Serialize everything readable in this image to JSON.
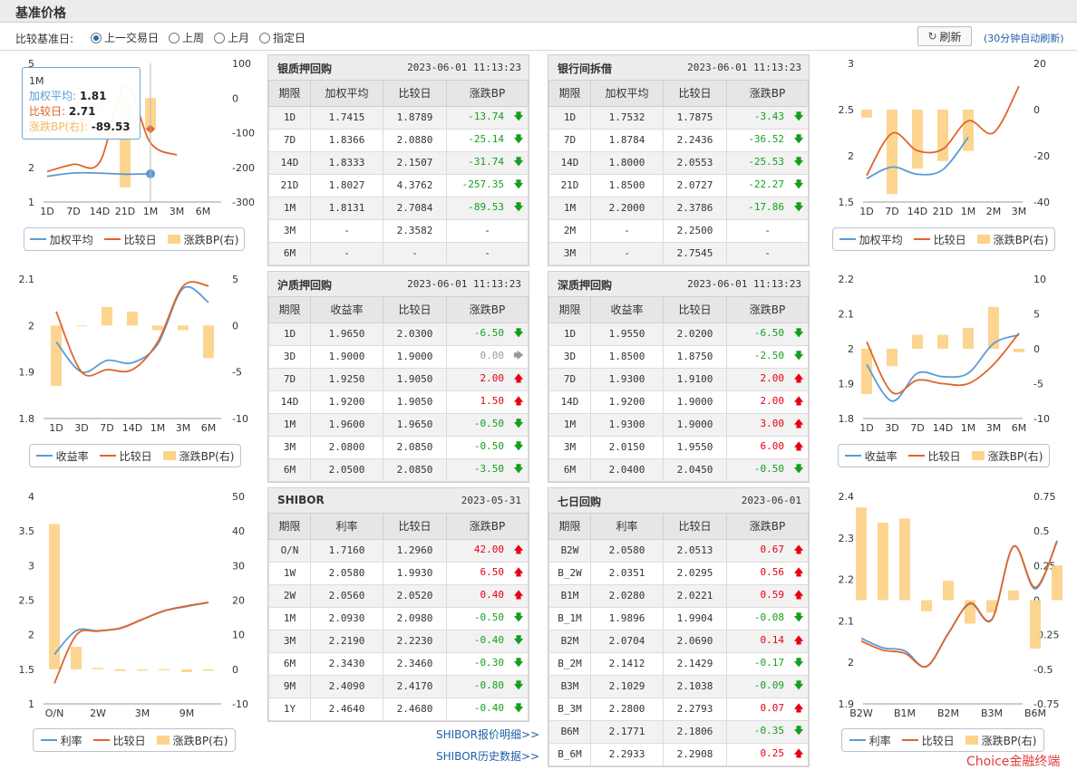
{
  "page": {
    "title": "基准价格"
  },
  "controls": {
    "compare_label": "比较基准日:",
    "options": [
      {
        "label": "上一交易日",
        "selected": true
      },
      {
        "label": "上周",
        "selected": false
      },
      {
        "label": "上月",
        "selected": false
      },
      {
        "label": "指定日",
        "selected": false
      }
    ],
    "refresh_label": "刷新",
    "auto_note": "(30分钟自动刷新)"
  },
  "colors": {
    "avg": "#5b9bd5",
    "compare": "#e0652a",
    "bp_bar": "#fcd38b",
    "up": "#e60012",
    "down": "#139f1c"
  },
  "tooltip": {
    "term": "1M",
    "avg_label": "加权平均:",
    "avg_value": "1.81",
    "cmp_label": "比较日:",
    "cmp_value": "2.71",
    "bp_label": "涨跌BP(右):",
    "bp_value": "-89.53"
  },
  "legends": {
    "a": [
      "加权平均",
      "比较日",
      "涨跌BP(右)"
    ],
    "b": [
      "收益率",
      "比较日",
      "涨跌BP(右)"
    ],
    "c": [
      "利率",
      "比较日",
      "涨跌BP(右)"
    ]
  },
  "tables": [
    {
      "name": "银质押回购",
      "date": "2023-06-01 11:13:23",
      "cols": [
        "期限",
        "加权平均",
        "比较日",
        "涨跌BP"
      ],
      "rows": [
        [
          "1D",
          "1.7415",
          "1.8789",
          "-13.74",
          "dn"
        ],
        [
          "7D",
          "1.8366",
          "2.0880",
          "-25.14",
          "dn"
        ],
        [
          "14D",
          "1.8333",
          "2.1507",
          "-31.74",
          "dn"
        ],
        [
          "21D",
          "1.8027",
          "4.3762",
          "-257.35",
          "dn"
        ],
        [
          "1M",
          "1.8131",
          "2.7084",
          "-89.53",
          "dn"
        ],
        [
          "3M",
          "-",
          "2.3582",
          "-",
          ""
        ],
        [
          "6M",
          "-",
          "-",
          "-",
          ""
        ]
      ]
    },
    {
      "name": "银行间拆借",
      "date": "2023-06-01 11:13:23",
      "cols": [
        "期限",
        "加权平均",
        "比较日",
        "涨跌BP"
      ],
      "rows": [
        [
          "1D",
          "1.7532",
          "1.7875",
          "-3.43",
          "dn"
        ],
        [
          "7D",
          "1.8784",
          "2.2436",
          "-36.52",
          "dn"
        ],
        [
          "14D",
          "1.8000",
          "2.0553",
          "-25.53",
          "dn"
        ],
        [
          "21D",
          "1.8500",
          "2.0727",
          "-22.27",
          "dn"
        ],
        [
          "1M",
          "2.2000",
          "2.3786",
          "-17.86",
          "dn"
        ],
        [
          "2M",
          "-",
          "2.2500",
          "-",
          ""
        ],
        [
          "3M",
          "-",
          "2.7545",
          "-",
          ""
        ]
      ]
    },
    {
      "name": "沪质押回购",
      "date": "2023-06-01 11:13:23",
      "cols": [
        "期限",
        "收益率",
        "比较日",
        "涨跌BP"
      ],
      "rows": [
        [
          "1D",
          "1.9650",
          "2.0300",
          "-6.50",
          "dn"
        ],
        [
          "3D",
          "1.9000",
          "1.9000",
          "0.00",
          "fl"
        ],
        [
          "7D",
          "1.9250",
          "1.9050",
          "2.00",
          "up"
        ],
        [
          "14D",
          "1.9200",
          "1.9050",
          "1.50",
          "up"
        ],
        [
          "1M",
          "1.9600",
          "1.9650",
          "-0.50",
          "dn"
        ],
        [
          "3M",
          "2.0800",
          "2.0850",
          "-0.50",
          "dn"
        ],
        [
          "6M",
          "2.0500",
          "2.0850",
          "-3.50",
          "dn"
        ]
      ]
    },
    {
      "name": "深质押回购",
      "date": "2023-06-01 11:13:23",
      "cols": [
        "期限",
        "收益率",
        "比较日",
        "涨跌BP"
      ],
      "rows": [
        [
          "1D",
          "1.9550",
          "2.0200",
          "-6.50",
          "dn"
        ],
        [
          "3D",
          "1.8500",
          "1.8750",
          "-2.50",
          "dn"
        ],
        [
          "7D",
          "1.9300",
          "1.9100",
          "2.00",
          "up"
        ],
        [
          "14D",
          "1.9200",
          "1.9000",
          "2.00",
          "up"
        ],
        [
          "1M",
          "1.9300",
          "1.9000",
          "3.00",
          "up"
        ],
        [
          "3M",
          "2.0150",
          "1.9550",
          "6.00",
          "up"
        ],
        [
          "6M",
          "2.0400",
          "2.0450",
          "-0.50",
          "dn"
        ]
      ]
    },
    {
      "name": "SHIBOR",
      "date": "2023-05-31",
      "cols": [
        "期限",
        "利率",
        "比较日",
        "涨跌BP"
      ],
      "rows": [
        [
          "O/N",
          "1.7160",
          "1.2960",
          "42.00",
          "up"
        ],
        [
          "1W",
          "2.0580",
          "1.9930",
          "6.50",
          "up"
        ],
        [
          "2W",
          "2.0560",
          "2.0520",
          "0.40",
          "up"
        ],
        [
          "1M",
          "2.0930",
          "2.0980",
          "-0.50",
          "dn"
        ],
        [
          "3M",
          "2.2190",
          "2.2230",
          "-0.40",
          "dn"
        ],
        [
          "6M",
          "2.3430",
          "2.3460",
          "-0.30",
          "dn"
        ],
        [
          "9M",
          "2.4090",
          "2.4170",
          "-0.80",
          "dn"
        ],
        [
          "1Y",
          "2.4640",
          "2.4680",
          "-0.40",
          "dn"
        ]
      ]
    },
    {
      "name": "七日回购",
      "date": "2023-06-01",
      "cols": [
        "期限",
        "利率",
        "比较日",
        "涨跌BP"
      ],
      "rows": [
        [
          "B2W",
          "2.0580",
          "2.0513",
          "0.67",
          "up"
        ],
        [
          "B_2W",
          "2.0351",
          "2.0295",
          "0.56",
          "up"
        ],
        [
          "B1M",
          "2.0280",
          "2.0221",
          "0.59",
          "up"
        ],
        [
          "B_1M",
          "1.9896",
          "1.9904",
          "-0.08",
          "dn"
        ],
        [
          "B2M",
          "2.0704",
          "2.0690",
          "0.14",
          "up"
        ],
        [
          "B_2M",
          "2.1412",
          "2.1429",
          "-0.17",
          "dn"
        ],
        [
          "B3M",
          "2.1029",
          "2.1038",
          "-0.09",
          "dn"
        ],
        [
          "B_3M",
          "2.2800",
          "2.2793",
          "0.07",
          "up"
        ],
        [
          "B6M",
          "2.1771",
          "2.1806",
          "-0.35",
          "dn"
        ],
        [
          "B_6M",
          "2.2933",
          "2.2908",
          "0.25",
          "up"
        ]
      ]
    }
  ],
  "links": {
    "shibor_detail": "SHIBOR报价明细>>",
    "shibor_history": "SHIBOR历史数据>>"
  },
  "brand": "Choice金融终端",
  "chart_data": [
    {
      "type": "line",
      "name": "银质押回购",
      "categories": [
        "1D",
        "7D",
        "14D",
        "21D",
        "1M",
        "3M",
        "6M"
      ],
      "series": [
        {
          "name": "加权平均",
          "values": [
            1.7415,
            1.8366,
            1.8333,
            1.8027,
            1.8131,
            null,
            null
          ]
        },
        {
          "name": "比较日",
          "values": [
            1.8789,
            2.088,
            2.1507,
            4.3762,
            2.7084,
            2.3582,
            null
          ]
        },
        {
          "name": "涨跌BP(右)",
          "kind": "bar",
          "values": [
            -13.74,
            -25.14,
            -31.74,
            -257.35,
            -89.53,
            null,
            null
          ]
        }
      ],
      "ylim_left": [
        1,
        5
      ],
      "yticks_left": [
        1,
        2,
        3,
        4,
        5
      ],
      "ylim_right": [
        -300,
        100
      ],
      "yticks_right": [
        100,
        0,
        -100,
        -200,
        -300
      ],
      "xticks": [
        "1D",
        "7D",
        "14D",
        "21D",
        "1M",
        "3M",
        "6M"
      ]
    },
    {
      "type": "line",
      "name": "银行间拆借",
      "categories": [
        "1D",
        "7D",
        "14D",
        "21D",
        "1M",
        "2M",
        "3M"
      ],
      "series": [
        {
          "name": "加权平均",
          "values": [
            1.7532,
            1.8784,
            1.8,
            1.85,
            2.2,
            null,
            null
          ]
        },
        {
          "name": "比较日",
          "values": [
            1.7875,
            2.2436,
            2.0553,
            2.0727,
            2.3786,
            2.25,
            2.7545
          ]
        },
        {
          "name": "涨跌BP(右)",
          "kind": "bar",
          "values": [
            -3.43,
            -36.52,
            -25.53,
            -22.27,
            -17.86,
            null,
            null
          ]
        }
      ],
      "ylim_left": [
        1.5,
        3
      ],
      "yticks_left": [
        1.5,
        2,
        2.5,
        3
      ],
      "ylim_right": [
        -40,
        20
      ],
      "yticks_right": [
        20,
        0,
        -20,
        -40
      ],
      "xticks": [
        "1D",
        "7D",
        "14D",
        "21D",
        "1M",
        "2M",
        "3M"
      ]
    },
    {
      "type": "line",
      "name": "沪质押回购",
      "categories": [
        "1D",
        "3D",
        "7D",
        "14D",
        "1M",
        "3M",
        "6M"
      ],
      "series": [
        {
          "name": "收益率",
          "values": [
            1.965,
            1.9,
            1.925,
            1.92,
            1.96,
            2.08,
            2.05
          ]
        },
        {
          "name": "比较日",
          "values": [
            2.03,
            1.9,
            1.905,
            1.905,
            1.965,
            2.085,
            2.085
          ]
        },
        {
          "name": "涨跌BP(右)",
          "kind": "bar",
          "values": [
            -6.5,
            0,
            2,
            1.5,
            -0.5,
            -0.5,
            -3.5
          ]
        }
      ],
      "ylim_left": [
        1.8,
        2.1
      ],
      "yticks_left": [
        1.8,
        1.9,
        2,
        2.1
      ],
      "ylim_right": [
        -10,
        5
      ],
      "yticks_right": [
        5,
        0,
        -5,
        -10
      ],
      "xticks": [
        "1D",
        "3D",
        "7D",
        "14D",
        "1M",
        "3M",
        "6M"
      ]
    },
    {
      "type": "line",
      "name": "深质押回购",
      "categories": [
        "1D",
        "3D",
        "7D",
        "14D",
        "1M",
        "3M",
        "6M"
      ],
      "series": [
        {
          "name": "收益率",
          "values": [
            1.955,
            1.85,
            1.93,
            1.92,
            1.93,
            2.015,
            2.04
          ]
        },
        {
          "name": "比较日",
          "values": [
            2.02,
            1.875,
            1.91,
            1.9,
            1.9,
            1.955,
            2.045
          ]
        },
        {
          "name": "涨跌BP(右)",
          "kind": "bar",
          "values": [
            -6.5,
            -2.5,
            2,
            2,
            3,
            6,
            -0.5
          ]
        }
      ],
      "ylim_left": [
        1.8,
        2.2
      ],
      "yticks_left": [
        1.8,
        1.9,
        2,
        2.1,
        2.2
      ],
      "ylim_right": [
        -10,
        10
      ],
      "yticks_right": [
        10,
        5,
        0,
        -5,
        -10
      ],
      "xticks": [
        "1D",
        "3D",
        "7D",
        "14D",
        "1M",
        "3M",
        "6M"
      ]
    },
    {
      "type": "line",
      "name": "SHIBOR",
      "categories": [
        "O/N",
        "1W",
        "2W",
        "1M",
        "3M",
        "6M",
        "9M",
        "1Y"
      ],
      "series": [
        {
          "name": "利率",
          "values": [
            1.716,
            2.058,
            2.056,
            2.093,
            2.219,
            2.343,
            2.409,
            2.464
          ]
        },
        {
          "name": "比较日",
          "values": [
            1.296,
            1.993,
            2.052,
            2.098,
            2.223,
            2.346,
            2.417,
            2.468
          ]
        },
        {
          "name": "涨跌BP(右)",
          "kind": "bar",
          "values": [
            42,
            6.5,
            0.4,
            -0.5,
            -0.4,
            -0.3,
            -0.8,
            -0.4
          ]
        }
      ],
      "ylim_left": [
        1,
        4
      ],
      "yticks_left": [
        1,
        1.5,
        2,
        2.5,
        3,
        3.5,
        4
      ],
      "ylim_right": [
        -10,
        50
      ],
      "yticks_right": [
        50,
        40,
        30,
        20,
        10,
        0,
        -10
      ],
      "xticks": [
        "O/N",
        "2W",
        "3M",
        "9M"
      ]
    },
    {
      "type": "line",
      "name": "七日回购",
      "categories": [
        "B2W",
        "B_2W",
        "B1M",
        "B_1M",
        "B2M",
        "B_2M",
        "B3M",
        "B_3M",
        "B6M",
        "B_6M"
      ],
      "series": [
        {
          "name": "利率",
          "values": [
            2.058,
            2.0351,
            2.028,
            1.9896,
            2.0704,
            2.1412,
            2.1029,
            2.28,
            2.1771,
            2.2933
          ]
        },
        {
          "name": "比较日",
          "values": [
            2.0513,
            2.0295,
            2.0221,
            1.9904,
            2.069,
            2.1429,
            2.1038,
            2.2793,
            2.1806,
            2.2908
          ]
        },
        {
          "name": "涨跌BP(右)",
          "kind": "bar",
          "values": [
            0.67,
            0.56,
            0.59,
            -0.08,
            0.14,
            -0.17,
            -0.09,
            0.07,
            -0.35,
            0.25
          ]
        }
      ],
      "ylim_left": [
        1.9,
        2.4
      ],
      "yticks_left": [
        1.9,
        2,
        2.1,
        2.2,
        2.3,
        2.4
      ],
      "ylim_right": [
        -0.75,
        0.75
      ],
      "yticks_right": [
        0.75,
        0.5,
        0.25,
        0,
        -0.25,
        -0.5,
        -0.75
      ],
      "xticks": [
        "B2W",
        "B1M",
        "B2M",
        "B3M",
        "B6M"
      ]
    }
  ]
}
